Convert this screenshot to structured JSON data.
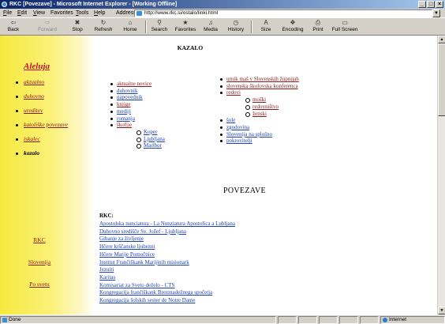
{
  "window": {
    "title": "RKC [Povezave] - Microsoft Internet Explorer - [Working Offline]",
    "controls": {
      "minimize": "_",
      "maximize": "□",
      "close": "×"
    }
  },
  "menu": {
    "items": [
      {
        "label": "File",
        "accel": "F",
        "rest": "ile"
      },
      {
        "label": "Edit",
        "accel": "E",
        "rest": "dit"
      },
      {
        "label": "View",
        "accel": "V",
        "rest": "iew"
      },
      {
        "label": "Favorites",
        "accel": "",
        "rest": "Favorites"
      },
      {
        "label": "Tools",
        "accel": "T",
        "rest": "ools"
      },
      {
        "label": "Help",
        "accel": "H",
        "rest": "elp"
      }
    ],
    "address_label": "Address",
    "address_value": "http://www.rkc.si/ostalo/linki.html"
  },
  "toolbar": {
    "buttons": [
      {
        "label": "Back",
        "icon": "back-arrow-icon",
        "glyph": "⇦",
        "enabled": true
      },
      {
        "label": "Forward",
        "icon": "forward-arrow-icon",
        "glyph": "⇨",
        "enabled": false
      },
      {
        "label": "Stop",
        "icon": "stop-icon",
        "glyph": "✖",
        "enabled": true
      },
      {
        "label": "Refresh",
        "icon": "refresh-icon",
        "glyph": "↻",
        "enabled": true
      },
      {
        "label": "Home",
        "icon": "home-icon",
        "glyph": "⌂",
        "enabled": true
      },
      {
        "label": "Search",
        "icon": "search-icon",
        "glyph": "⚲",
        "enabled": true
      },
      {
        "label": "Favorites",
        "icon": "favorites-icon",
        "glyph": "★",
        "enabled": true
      },
      {
        "label": "Media",
        "icon": "media-icon",
        "glyph": "♫",
        "enabled": true
      },
      {
        "label": "History",
        "icon": "history-icon",
        "glyph": "◷",
        "enabled": true
      },
      {
        "label": "Size",
        "icon": "text-size-icon",
        "glyph": "A",
        "enabled": true
      },
      {
        "label": "Encoding",
        "icon": "encoding-icon",
        "glyph": "❖",
        "enabled": true
      },
      {
        "label": "Print",
        "icon": "print-icon",
        "glyph": "⎙",
        "enabled": true
      },
      {
        "label": "Full Screen",
        "icon": "fullscreen-icon",
        "glyph": "▭",
        "enabled": true
      }
    ]
  },
  "sidebar": {
    "logo": "Aleluja",
    "nav": [
      {
        "label": "aktualno",
        "current": false
      },
      {
        "label": "duhovno",
        "current": false
      },
      {
        "label": "uredi­tev",
        "current": false
      },
      {
        "label": "katoliške povezave",
        "current": false
      },
      {
        "label": "iskalec",
        "current": false
      },
      {
        "label": "kazalo",
        "current": true
      }
    ],
    "links": [
      "RKC",
      "Slovenija",
      "Po svetu"
    ]
  },
  "main": {
    "kazalo_title": "KAZALO",
    "left_list": [
      {
        "label": "aktualne novice",
        "color": "red"
      },
      {
        "label": "duhovnik",
        "color": "blue"
      },
      {
        "label": "napovednik",
        "color": "blue"
      },
      {
        "label": "knjige",
        "color": "red"
      },
      {
        "label": "mediji",
        "color": "blue"
      },
      {
        "label": "romanja",
        "color": "blue"
      },
      {
        "label": "škofije",
        "color": "red",
        "children": [
          "Koper",
          "Ljubljana",
          "Maribor"
        ]
      }
    ],
    "right_list": [
      {
        "label": "urnik maš v Slovenskih župnijah",
        "color": "red"
      },
      {
        "label": "slovenska škofovska konferenca",
        "color": "red"
      },
      {
        "label": "redovi",
        "color": "red",
        "children": [
          "moški",
          "redovništvo",
          "ženski"
        ]
      },
      {
        "label": "šole",
        "color": "blue"
      },
      {
        "label": "zgodovina",
        "color": "blue"
      },
      {
        "label": "Slovenija na splošno",
        "color": "blue"
      },
      {
        "label": "pokrovitelji",
        "color": "blue"
      }
    ],
    "povezave_title": "POVEZAVE",
    "section_label": "RKC:",
    "links": [
      "Apostolska nunciatura - La Nunziatura Apostolica a Lubljana",
      "Duhovno središče Sv. Jožef - Ljubljana",
      "Gibanje za življenje",
      "Hčere krščanske ljubezni",
      "Hčere Marije Pomočnice",
      "Institut Frančiškank Marijinih misionark",
      "Jezuiti",
      "Karitas",
      "Komisariat za Sveto deželo - CTS",
      "Kongregacija frančiškank Brezmadežnega spočetja",
      "Kongregacija šolskih sester de Notre Dame"
    ]
  },
  "statusbar": {
    "status": "Done",
    "zone": "Internet"
  },
  "colors": {
    "link_blue": "#1a3fb8",
    "link_red": "#8b1a1a",
    "sidebar_yellow": "#f5e93e",
    "logo_red": "#c8102e",
    "titlebar_blue": "#0a246a"
  }
}
